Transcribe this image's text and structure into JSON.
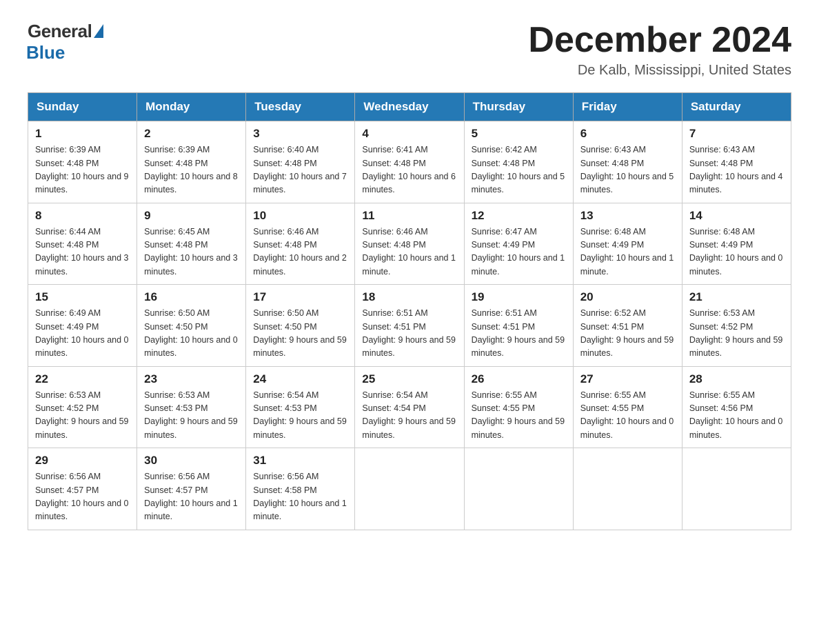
{
  "logo": {
    "general": "General",
    "blue": "Blue"
  },
  "title": {
    "month": "December 2024",
    "location": "De Kalb, Mississippi, United States"
  },
  "weekdays": [
    "Sunday",
    "Monday",
    "Tuesday",
    "Wednesday",
    "Thursday",
    "Friday",
    "Saturday"
  ],
  "weeks": [
    [
      {
        "day": "1",
        "sunrise": "6:39 AM",
        "sunset": "4:48 PM",
        "daylight": "10 hours and 9 minutes."
      },
      {
        "day": "2",
        "sunrise": "6:39 AM",
        "sunset": "4:48 PM",
        "daylight": "10 hours and 8 minutes."
      },
      {
        "day": "3",
        "sunrise": "6:40 AM",
        "sunset": "4:48 PM",
        "daylight": "10 hours and 7 minutes."
      },
      {
        "day": "4",
        "sunrise": "6:41 AM",
        "sunset": "4:48 PM",
        "daylight": "10 hours and 6 minutes."
      },
      {
        "day": "5",
        "sunrise": "6:42 AM",
        "sunset": "4:48 PM",
        "daylight": "10 hours and 5 minutes."
      },
      {
        "day": "6",
        "sunrise": "6:43 AM",
        "sunset": "4:48 PM",
        "daylight": "10 hours and 5 minutes."
      },
      {
        "day": "7",
        "sunrise": "6:43 AM",
        "sunset": "4:48 PM",
        "daylight": "10 hours and 4 minutes."
      }
    ],
    [
      {
        "day": "8",
        "sunrise": "6:44 AM",
        "sunset": "4:48 PM",
        "daylight": "10 hours and 3 minutes."
      },
      {
        "day": "9",
        "sunrise": "6:45 AM",
        "sunset": "4:48 PM",
        "daylight": "10 hours and 3 minutes."
      },
      {
        "day": "10",
        "sunrise": "6:46 AM",
        "sunset": "4:48 PM",
        "daylight": "10 hours and 2 minutes."
      },
      {
        "day": "11",
        "sunrise": "6:46 AM",
        "sunset": "4:48 PM",
        "daylight": "10 hours and 1 minute."
      },
      {
        "day": "12",
        "sunrise": "6:47 AM",
        "sunset": "4:49 PM",
        "daylight": "10 hours and 1 minute."
      },
      {
        "day": "13",
        "sunrise": "6:48 AM",
        "sunset": "4:49 PM",
        "daylight": "10 hours and 1 minute."
      },
      {
        "day": "14",
        "sunrise": "6:48 AM",
        "sunset": "4:49 PM",
        "daylight": "10 hours and 0 minutes."
      }
    ],
    [
      {
        "day": "15",
        "sunrise": "6:49 AM",
        "sunset": "4:49 PM",
        "daylight": "10 hours and 0 minutes."
      },
      {
        "day": "16",
        "sunrise": "6:50 AM",
        "sunset": "4:50 PM",
        "daylight": "10 hours and 0 minutes."
      },
      {
        "day": "17",
        "sunrise": "6:50 AM",
        "sunset": "4:50 PM",
        "daylight": "9 hours and 59 minutes."
      },
      {
        "day": "18",
        "sunrise": "6:51 AM",
        "sunset": "4:51 PM",
        "daylight": "9 hours and 59 minutes."
      },
      {
        "day": "19",
        "sunrise": "6:51 AM",
        "sunset": "4:51 PM",
        "daylight": "9 hours and 59 minutes."
      },
      {
        "day": "20",
        "sunrise": "6:52 AM",
        "sunset": "4:51 PM",
        "daylight": "9 hours and 59 minutes."
      },
      {
        "day": "21",
        "sunrise": "6:53 AM",
        "sunset": "4:52 PM",
        "daylight": "9 hours and 59 minutes."
      }
    ],
    [
      {
        "day": "22",
        "sunrise": "6:53 AM",
        "sunset": "4:52 PM",
        "daylight": "9 hours and 59 minutes."
      },
      {
        "day": "23",
        "sunrise": "6:53 AM",
        "sunset": "4:53 PM",
        "daylight": "9 hours and 59 minutes."
      },
      {
        "day": "24",
        "sunrise": "6:54 AM",
        "sunset": "4:53 PM",
        "daylight": "9 hours and 59 minutes."
      },
      {
        "day": "25",
        "sunrise": "6:54 AM",
        "sunset": "4:54 PM",
        "daylight": "9 hours and 59 minutes."
      },
      {
        "day": "26",
        "sunrise": "6:55 AM",
        "sunset": "4:55 PM",
        "daylight": "9 hours and 59 minutes."
      },
      {
        "day": "27",
        "sunrise": "6:55 AM",
        "sunset": "4:55 PM",
        "daylight": "10 hours and 0 minutes."
      },
      {
        "day": "28",
        "sunrise": "6:55 AM",
        "sunset": "4:56 PM",
        "daylight": "10 hours and 0 minutes."
      }
    ],
    [
      {
        "day": "29",
        "sunrise": "6:56 AM",
        "sunset": "4:57 PM",
        "daylight": "10 hours and 0 minutes."
      },
      {
        "day": "30",
        "sunrise": "6:56 AM",
        "sunset": "4:57 PM",
        "daylight": "10 hours and 1 minute."
      },
      {
        "day": "31",
        "sunrise": "6:56 AM",
        "sunset": "4:58 PM",
        "daylight": "10 hours and 1 minute."
      },
      null,
      null,
      null,
      null
    ]
  ],
  "labels": {
    "sunrise": "Sunrise:",
    "sunset": "Sunset:",
    "daylight": "Daylight:"
  }
}
